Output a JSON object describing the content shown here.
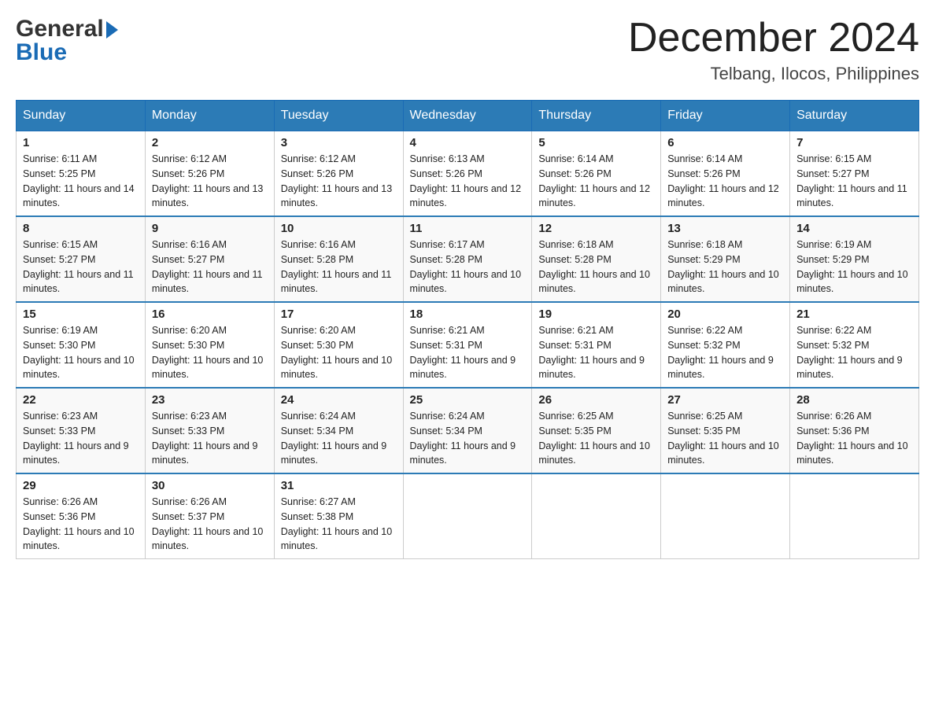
{
  "logo": {
    "text_general": "General",
    "text_blue": "Blue"
  },
  "header": {
    "month_year": "December 2024",
    "location": "Telbang, Ilocos, Philippines"
  },
  "days_of_week": [
    "Sunday",
    "Monday",
    "Tuesday",
    "Wednesday",
    "Thursday",
    "Friday",
    "Saturday"
  ],
  "weeks": [
    [
      {
        "day": "1",
        "sunrise": "6:11 AM",
        "sunset": "5:25 PM",
        "daylight": "11 hours and 14 minutes."
      },
      {
        "day": "2",
        "sunrise": "6:12 AM",
        "sunset": "5:26 PM",
        "daylight": "11 hours and 13 minutes."
      },
      {
        "day": "3",
        "sunrise": "6:12 AM",
        "sunset": "5:26 PM",
        "daylight": "11 hours and 13 minutes."
      },
      {
        "day": "4",
        "sunrise": "6:13 AM",
        "sunset": "5:26 PM",
        "daylight": "11 hours and 12 minutes."
      },
      {
        "day": "5",
        "sunrise": "6:14 AM",
        "sunset": "5:26 PM",
        "daylight": "11 hours and 12 minutes."
      },
      {
        "day": "6",
        "sunrise": "6:14 AM",
        "sunset": "5:26 PM",
        "daylight": "11 hours and 12 minutes."
      },
      {
        "day": "7",
        "sunrise": "6:15 AM",
        "sunset": "5:27 PM",
        "daylight": "11 hours and 11 minutes."
      }
    ],
    [
      {
        "day": "8",
        "sunrise": "6:15 AM",
        "sunset": "5:27 PM",
        "daylight": "11 hours and 11 minutes."
      },
      {
        "day": "9",
        "sunrise": "6:16 AM",
        "sunset": "5:27 PM",
        "daylight": "11 hours and 11 minutes."
      },
      {
        "day": "10",
        "sunrise": "6:16 AM",
        "sunset": "5:28 PM",
        "daylight": "11 hours and 11 minutes."
      },
      {
        "day": "11",
        "sunrise": "6:17 AM",
        "sunset": "5:28 PM",
        "daylight": "11 hours and 10 minutes."
      },
      {
        "day": "12",
        "sunrise": "6:18 AM",
        "sunset": "5:28 PM",
        "daylight": "11 hours and 10 minutes."
      },
      {
        "day": "13",
        "sunrise": "6:18 AM",
        "sunset": "5:29 PM",
        "daylight": "11 hours and 10 minutes."
      },
      {
        "day": "14",
        "sunrise": "6:19 AM",
        "sunset": "5:29 PM",
        "daylight": "11 hours and 10 minutes."
      }
    ],
    [
      {
        "day": "15",
        "sunrise": "6:19 AM",
        "sunset": "5:30 PM",
        "daylight": "11 hours and 10 minutes."
      },
      {
        "day": "16",
        "sunrise": "6:20 AM",
        "sunset": "5:30 PM",
        "daylight": "11 hours and 10 minutes."
      },
      {
        "day": "17",
        "sunrise": "6:20 AM",
        "sunset": "5:30 PM",
        "daylight": "11 hours and 10 minutes."
      },
      {
        "day": "18",
        "sunrise": "6:21 AM",
        "sunset": "5:31 PM",
        "daylight": "11 hours and 9 minutes."
      },
      {
        "day": "19",
        "sunrise": "6:21 AM",
        "sunset": "5:31 PM",
        "daylight": "11 hours and 9 minutes."
      },
      {
        "day": "20",
        "sunrise": "6:22 AM",
        "sunset": "5:32 PM",
        "daylight": "11 hours and 9 minutes."
      },
      {
        "day": "21",
        "sunrise": "6:22 AM",
        "sunset": "5:32 PM",
        "daylight": "11 hours and 9 minutes."
      }
    ],
    [
      {
        "day": "22",
        "sunrise": "6:23 AM",
        "sunset": "5:33 PM",
        "daylight": "11 hours and 9 minutes."
      },
      {
        "day": "23",
        "sunrise": "6:23 AM",
        "sunset": "5:33 PM",
        "daylight": "11 hours and 9 minutes."
      },
      {
        "day": "24",
        "sunrise": "6:24 AM",
        "sunset": "5:34 PM",
        "daylight": "11 hours and 9 minutes."
      },
      {
        "day": "25",
        "sunrise": "6:24 AM",
        "sunset": "5:34 PM",
        "daylight": "11 hours and 9 minutes."
      },
      {
        "day": "26",
        "sunrise": "6:25 AM",
        "sunset": "5:35 PM",
        "daylight": "11 hours and 10 minutes."
      },
      {
        "day": "27",
        "sunrise": "6:25 AM",
        "sunset": "5:35 PM",
        "daylight": "11 hours and 10 minutes."
      },
      {
        "day": "28",
        "sunrise": "6:26 AM",
        "sunset": "5:36 PM",
        "daylight": "11 hours and 10 minutes."
      }
    ],
    [
      {
        "day": "29",
        "sunrise": "6:26 AM",
        "sunset": "5:36 PM",
        "daylight": "11 hours and 10 minutes."
      },
      {
        "day": "30",
        "sunrise": "6:26 AM",
        "sunset": "5:37 PM",
        "daylight": "11 hours and 10 minutes."
      },
      {
        "day": "31",
        "sunrise": "6:27 AM",
        "sunset": "5:38 PM",
        "daylight": "11 hours and 10 minutes."
      },
      null,
      null,
      null,
      null
    ]
  ],
  "labels": {
    "sunrise": "Sunrise:",
    "sunset": "Sunset:",
    "daylight": "Daylight:"
  }
}
